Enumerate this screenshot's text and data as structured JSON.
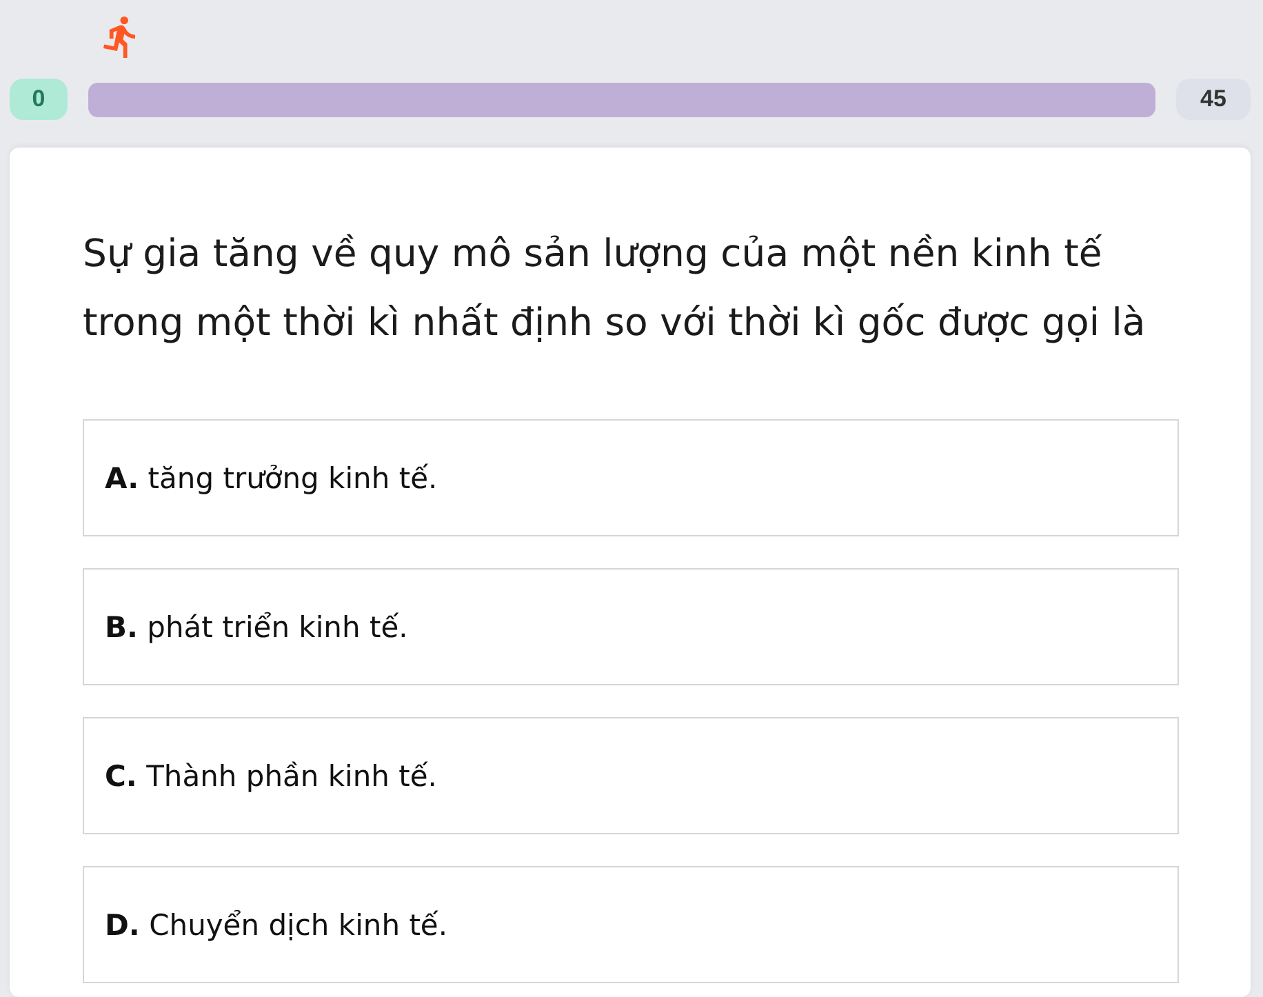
{
  "progress": {
    "score": "0",
    "total": "45",
    "level": 0
  },
  "question": "Sự gia tăng về quy mô sản lượng của một nền kinh tế trong một thời kì nhất định so với thời kì gốc được gọi là",
  "options": [
    {
      "letter": "A.",
      "text": "tăng trưởng kinh tế.",
      "selected": false
    },
    {
      "letter": "B.",
      "text": "phát triển kinh tế.",
      "selected": false
    },
    {
      "letter": "C.",
      "text": "Thành phần kinh tế.",
      "selected": false
    },
    {
      "letter": "D.",
      "text": "Chuyển dịch kinh tế.",
      "selected": false
    }
  ]
}
